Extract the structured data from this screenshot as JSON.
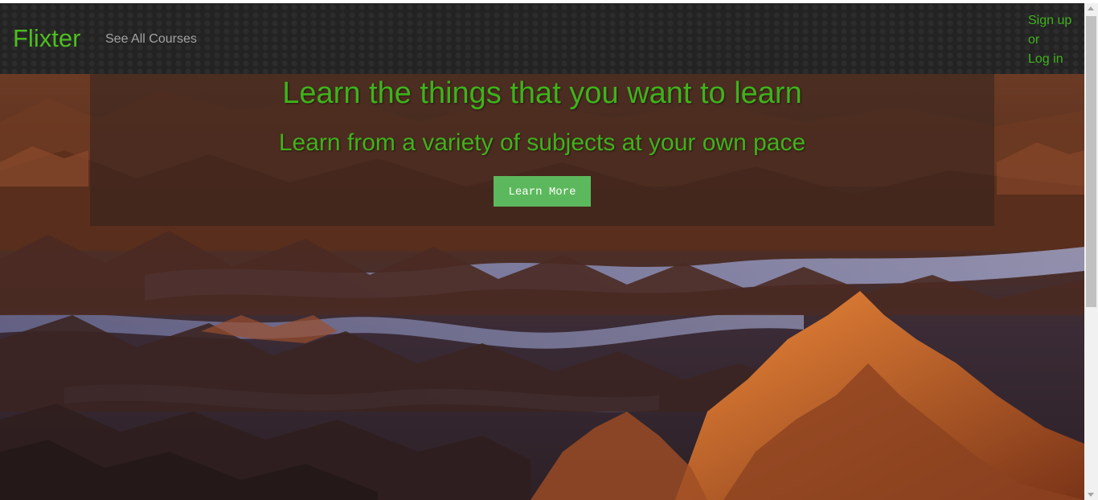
{
  "navbar": {
    "brand": "Flixter",
    "courses_link": "See All Courses",
    "auth": {
      "sign_up": "Sign up",
      "or": "or",
      "log_in": "Log in"
    }
  },
  "hero": {
    "title": "Learn the things that you want to learn",
    "subtitle": "Learn from a variety of subjects at your own pace",
    "cta_label": "Learn More"
  },
  "colors": {
    "brand_green": "#4dbd1f",
    "hero_text_green": "#3fb21c",
    "button_green": "#5cb85c",
    "navbar_bg": "#232323"
  }
}
